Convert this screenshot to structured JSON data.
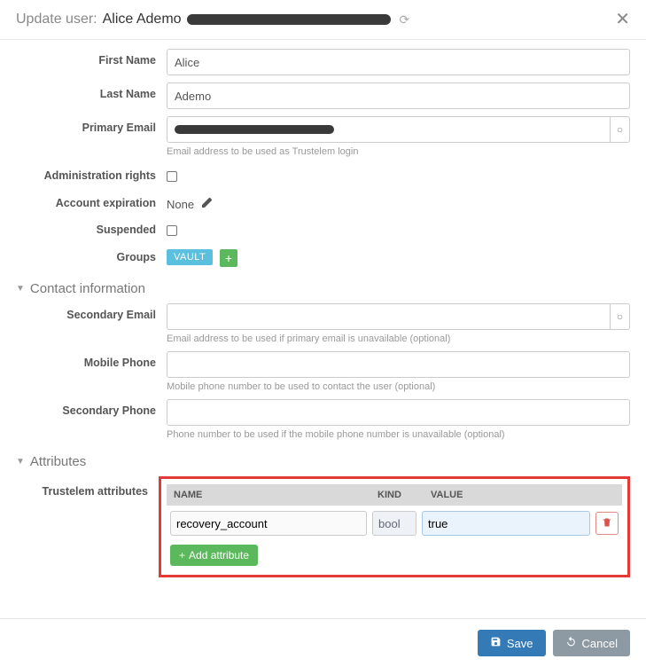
{
  "header": {
    "prefix": "Update user:",
    "username": "Alice Ademo"
  },
  "form": {
    "first_name": {
      "label": "First Name",
      "value": "Alice"
    },
    "last_name": {
      "label": "Last Name",
      "value": "Ademo"
    },
    "primary_email": {
      "label": "Primary Email",
      "value": "",
      "helper": "Email address to be used as Trustelem login"
    },
    "admin_rights": {
      "label": "Administration rights",
      "checked": false
    },
    "account_expiration": {
      "label": "Account expiration",
      "value": "None"
    },
    "suspended": {
      "label": "Suspended",
      "checked": false
    },
    "groups": {
      "label": "Groups",
      "tags": [
        "VAULT"
      ]
    }
  },
  "sections": {
    "contact": {
      "title": "Contact information",
      "secondary_email": {
        "label": "Secondary Email",
        "value": "",
        "helper": "Email address to be used if primary email is unavailable (optional)"
      },
      "mobile_phone": {
        "label": "Mobile Phone",
        "value": "",
        "helper": "Mobile phone number to be used to contact the user (optional)"
      },
      "secondary_phone": {
        "label": "Secondary Phone",
        "value": "",
        "helper": "Phone number to be used if the mobile phone number is unavailable (optional)"
      }
    },
    "attributes": {
      "title": "Attributes",
      "label": "Trustelem attributes",
      "columns": {
        "name": "NAME",
        "kind": "KIND",
        "value": "VALUE"
      },
      "rows": [
        {
          "name": "recovery_account",
          "kind": "bool",
          "value": "true"
        }
      ],
      "add_label": "Add attribute"
    }
  },
  "footer": {
    "save": "Save",
    "cancel": "Cancel"
  }
}
